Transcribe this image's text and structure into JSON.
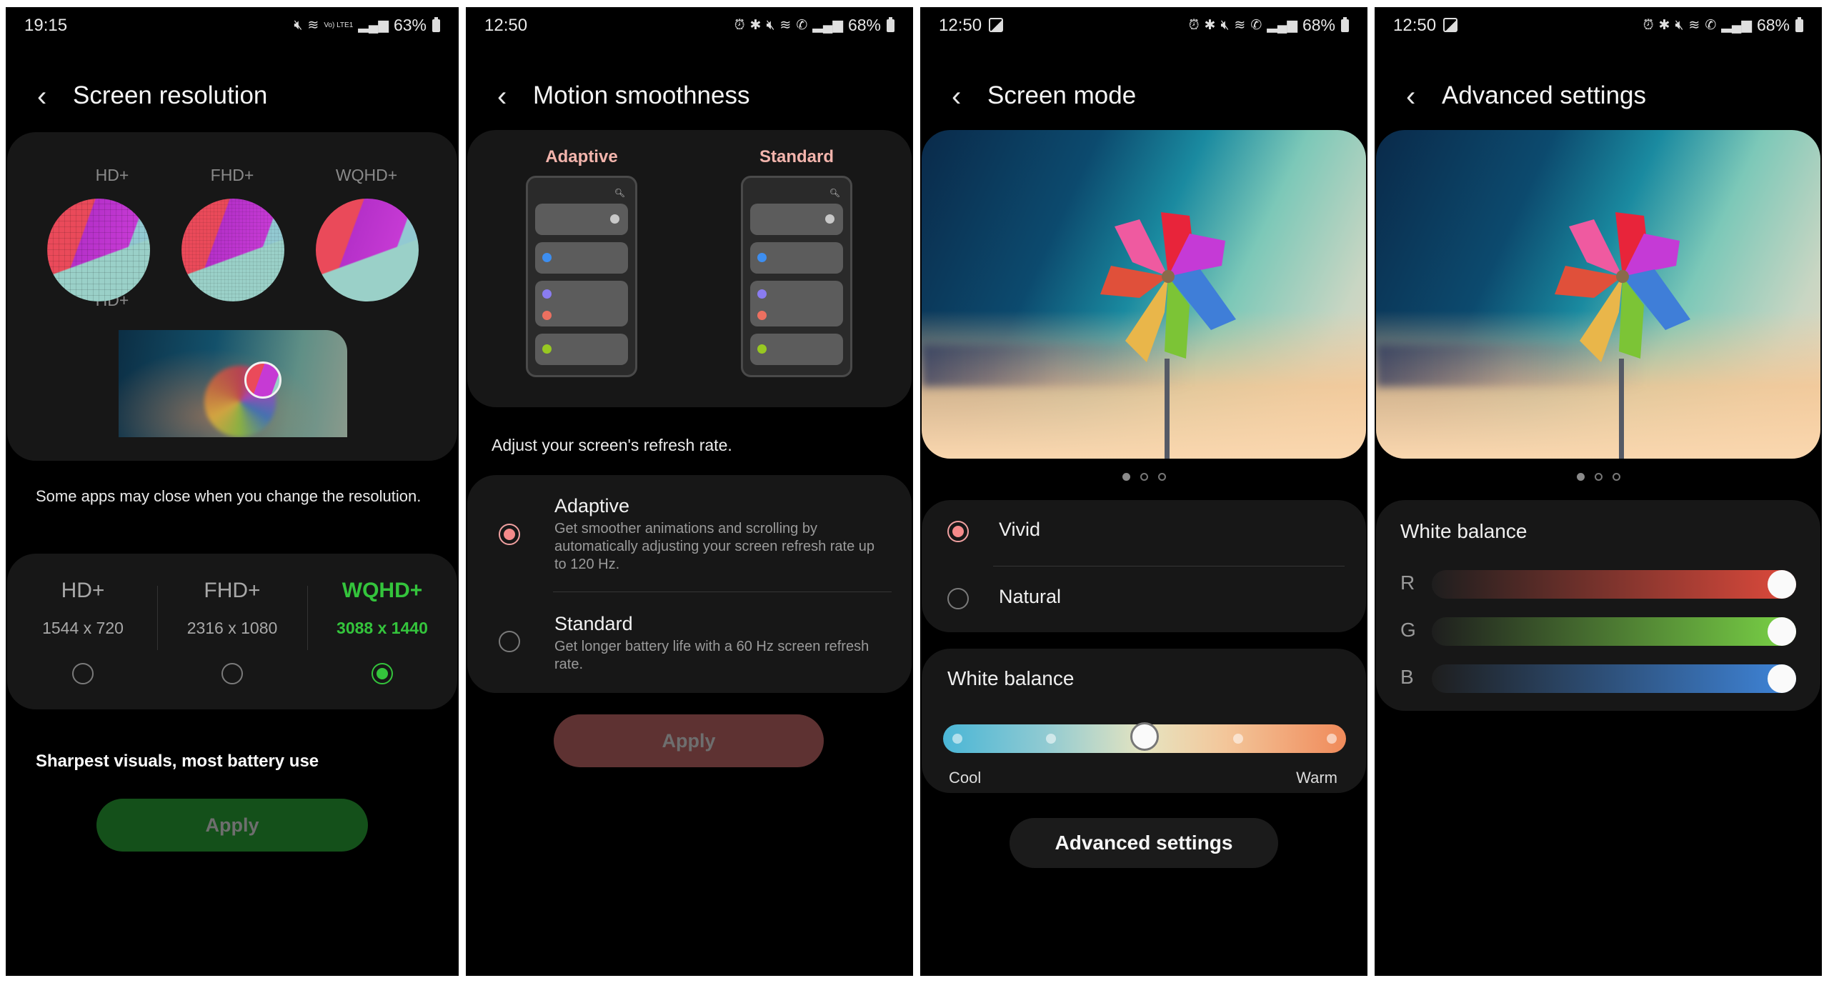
{
  "panels": [
    {
      "status": {
        "time": "19:15",
        "battery": "63%",
        "icons": [
          "mute-icon",
          "wifi-icon",
          "volte-lte-icon",
          "signal-icon",
          "battery-icon"
        ],
        "volte_text": "Vo) LTE1"
      },
      "header": {
        "back_icon": "chevron-left-icon",
        "title": "Screen resolution"
      },
      "preview": {
        "labels": [
          "HD+",
          "FHD+",
          "WQHD+"
        ]
      },
      "note": "Some apps may close when you change the resolution.",
      "options": [
        {
          "name": "HD+",
          "dimensions": "1544 x 720",
          "selected": false
        },
        {
          "name": "FHD+",
          "dimensions": "2316 x 1080",
          "selected": false
        },
        {
          "name": "WQHD+",
          "dimensions": "3088 x 1440",
          "selected": true
        }
      ],
      "caption": "Sharpest visuals, most battery use",
      "apply_label": "Apply",
      "accent_color": "#34c43c",
      "apply_color": "#14501a"
    },
    {
      "status": {
        "time": "12:50",
        "battery": "68%",
        "icons": [
          "alarm-icon",
          "bluetooth-icon",
          "mute-icon",
          "wifi-icon",
          "wifi-calling-icon",
          "signal-icon",
          "battery-icon"
        ]
      },
      "header": {
        "back_icon": "chevron-left-icon",
        "title": "Motion smoothness"
      },
      "preview": {
        "labels": [
          "Adaptive",
          "Standard"
        ]
      },
      "subtitle": "Adjust your screen's refresh rate.",
      "options": [
        {
          "title": "Adaptive",
          "description": "Get smoother animations and scrolling by automatically adjusting your screen refresh rate up to 120 Hz.",
          "selected": true
        },
        {
          "title": "Standard",
          "description": "Get longer battery life with a 60 Hz screen refresh rate.",
          "selected": false
        }
      ],
      "apply_label": "Apply",
      "accent_color": "#f58a8a",
      "apply_color": "#5e3232"
    },
    {
      "status": {
        "time": "12:50",
        "battery": "68%",
        "icons": [
          "gallery-icon",
          "alarm-icon",
          "bluetooth-icon",
          "mute-icon",
          "wifi-icon",
          "wifi-calling-icon",
          "signal-icon",
          "battery-icon"
        ]
      },
      "header": {
        "back_icon": "chevron-left-icon",
        "title": "Screen mode"
      },
      "pager": {
        "count": 3,
        "active": 0
      },
      "modes": [
        {
          "label": "Vivid",
          "selected": true
        },
        {
          "label": "Natural",
          "selected": false
        }
      ],
      "white_balance": {
        "title": "White balance",
        "min_label": "Cool",
        "max_label": "Warm",
        "steps": 5,
        "value_step": 3
      },
      "advanced_label": "Advanced settings"
    },
    {
      "status": {
        "time": "12:50",
        "battery": "68%",
        "icons": [
          "gallery-icon",
          "alarm-icon",
          "bluetooth-icon",
          "mute-icon",
          "wifi-icon",
          "wifi-calling-icon",
          "signal-icon",
          "battery-icon"
        ]
      },
      "header": {
        "back_icon": "chevron-left-icon",
        "title": "Advanced settings"
      },
      "pager": {
        "count": 3,
        "active": 0
      },
      "white_balance": {
        "title": "White balance",
        "channels": [
          {
            "label": "R",
            "value_percent": 100,
            "color": "#e04a3c"
          },
          {
            "label": "G",
            "value_percent": 100,
            "color": "#7ad446"
          },
          {
            "label": "B",
            "value_percent": 100,
            "color": "#3f86dc"
          }
        ]
      }
    }
  ]
}
